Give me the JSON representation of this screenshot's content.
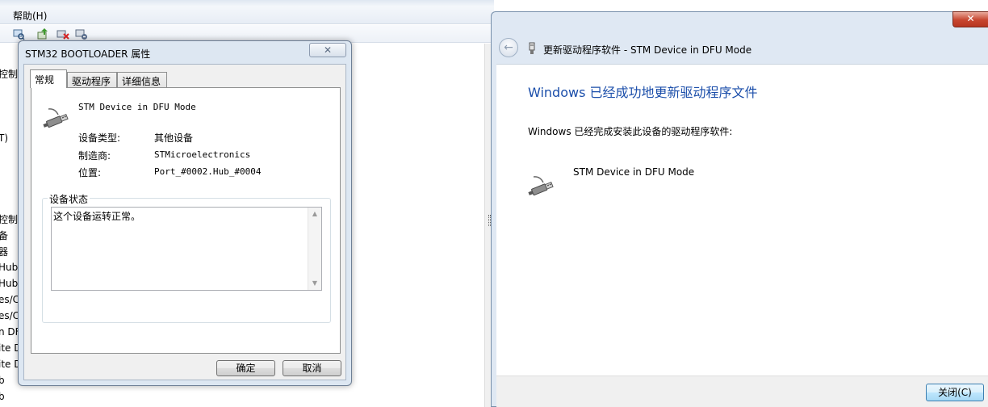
{
  "devmgr": {
    "menu_help": "帮助(H)",
    "tree_fragments": [
      "控制器",
      "T)",
      "控制器",
      "备",
      "器",
      "Hub",
      "Hub",
      "es/C",
      "es/C",
      "n DF",
      "ite D",
      "ite D",
      "b",
      "b"
    ]
  },
  "props": {
    "title": "STM32  BOOTLOADER 属性",
    "close_glyph": "✕",
    "tabs": [
      {
        "label": "常规",
        "active": true
      },
      {
        "label": "驱动程序",
        "active": false
      },
      {
        "label": "详细信息",
        "active": false
      }
    ],
    "device_name": "STM Device in DFU Mode",
    "properties": [
      {
        "label": "设备类型:",
        "value": "其他设备"
      },
      {
        "label": "制造商:",
        "value": "STMicroelectronics"
      },
      {
        "label": "位置:",
        "value": "Port_#0002.Hub_#0004"
      }
    ],
    "status_group_label": "设备状态",
    "status_text": "这个设备运转正常。",
    "ok_label": "确定",
    "cancel_label": "取消"
  },
  "wizard": {
    "nav_title": "更新驱动程序软件 - STM Device in DFU Mode",
    "heading": "Windows 已经成功地更新驱动程序文件",
    "description": "Windows 已经完成安装此设备的驱动程序软件:",
    "device_name": "STM Device in DFU Mode",
    "close_label": "关闭(C)",
    "caption_close_glyph": "✕",
    "back_glyph": "←"
  }
}
